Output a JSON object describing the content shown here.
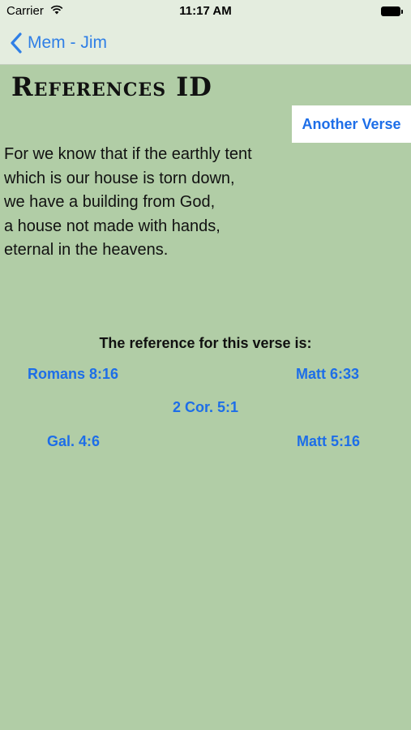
{
  "status_bar": {
    "carrier": "Carrier",
    "time": "11:17 AM"
  },
  "nav": {
    "back_label": "Mem - Jim"
  },
  "page": {
    "title": "References ID",
    "another_verse_label": "Another Verse"
  },
  "verse": {
    "lines": [
      "For we know that if the earthly tent",
      "which is our house is torn down,",
      "we have a building from God,",
      "a house not made with hands,",
      "eternal in the heavens."
    ]
  },
  "reference": {
    "prompt": "The reference for this verse is:",
    "options": [
      "Romans 8:16",
      "Matt 6:33",
      "2 Cor. 5:1",
      "Gal. 4:6",
      "Matt 5:16"
    ]
  },
  "colors": {
    "background": "#b1cda6",
    "bar": "#e4eddf",
    "accent": "#1d6ee8"
  }
}
